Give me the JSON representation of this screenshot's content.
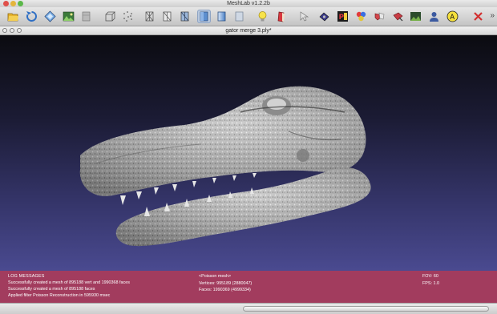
{
  "app_title": "MeshLab v1.2.2b",
  "toolbar": {
    "icons": [
      "open-folder-icon",
      "reload-icon",
      "reset-trackball-icon",
      "snapshot-icon",
      "raster-layer-icon",
      "bounding-box-icon",
      "points-icon",
      "wireframe-icon",
      "hidden-lines-icon",
      "flat-lines-icon",
      "flat-shading-icon",
      "smooth-shading-icon",
      "texture-icon",
      "lighting-icon",
      "backface-icon",
      "select-icon",
      "edit-tool-icon",
      "paint-icon",
      "color-icon",
      "align-icon",
      "measure-icon",
      "landscape-icon",
      "sculpt-icon",
      "annotate-icon",
      "delete-icon"
    ],
    "overflow_label": "»"
  },
  "document": {
    "title": "gator merge 3.ply*"
  },
  "colors": {
    "viewport_top": "#0b0b10",
    "viewport_bottom": "#4a4a90",
    "info_panel": "#a23c5e",
    "mesh": "#c8c8c8"
  },
  "info": {
    "log_title": "LOG MESSAGES",
    "log_lines": [
      "Successfully created a mesh of 895188 vert and 1990368 faces",
      "Successfully created a mesh of 895188 faces",
      "Applied filter Poisson Reconstruction in 595930 msec"
    ],
    "mesh_name": "<Poisson mesh>",
    "vertices": "Vertices: 995189 (2880047)",
    "faces": "Faces: 1990369 (4999334)",
    "fov": "FOV:  60",
    "fps": "FPS:    1.0"
  },
  "status": {
    "progress_fraction": 0.0
  }
}
